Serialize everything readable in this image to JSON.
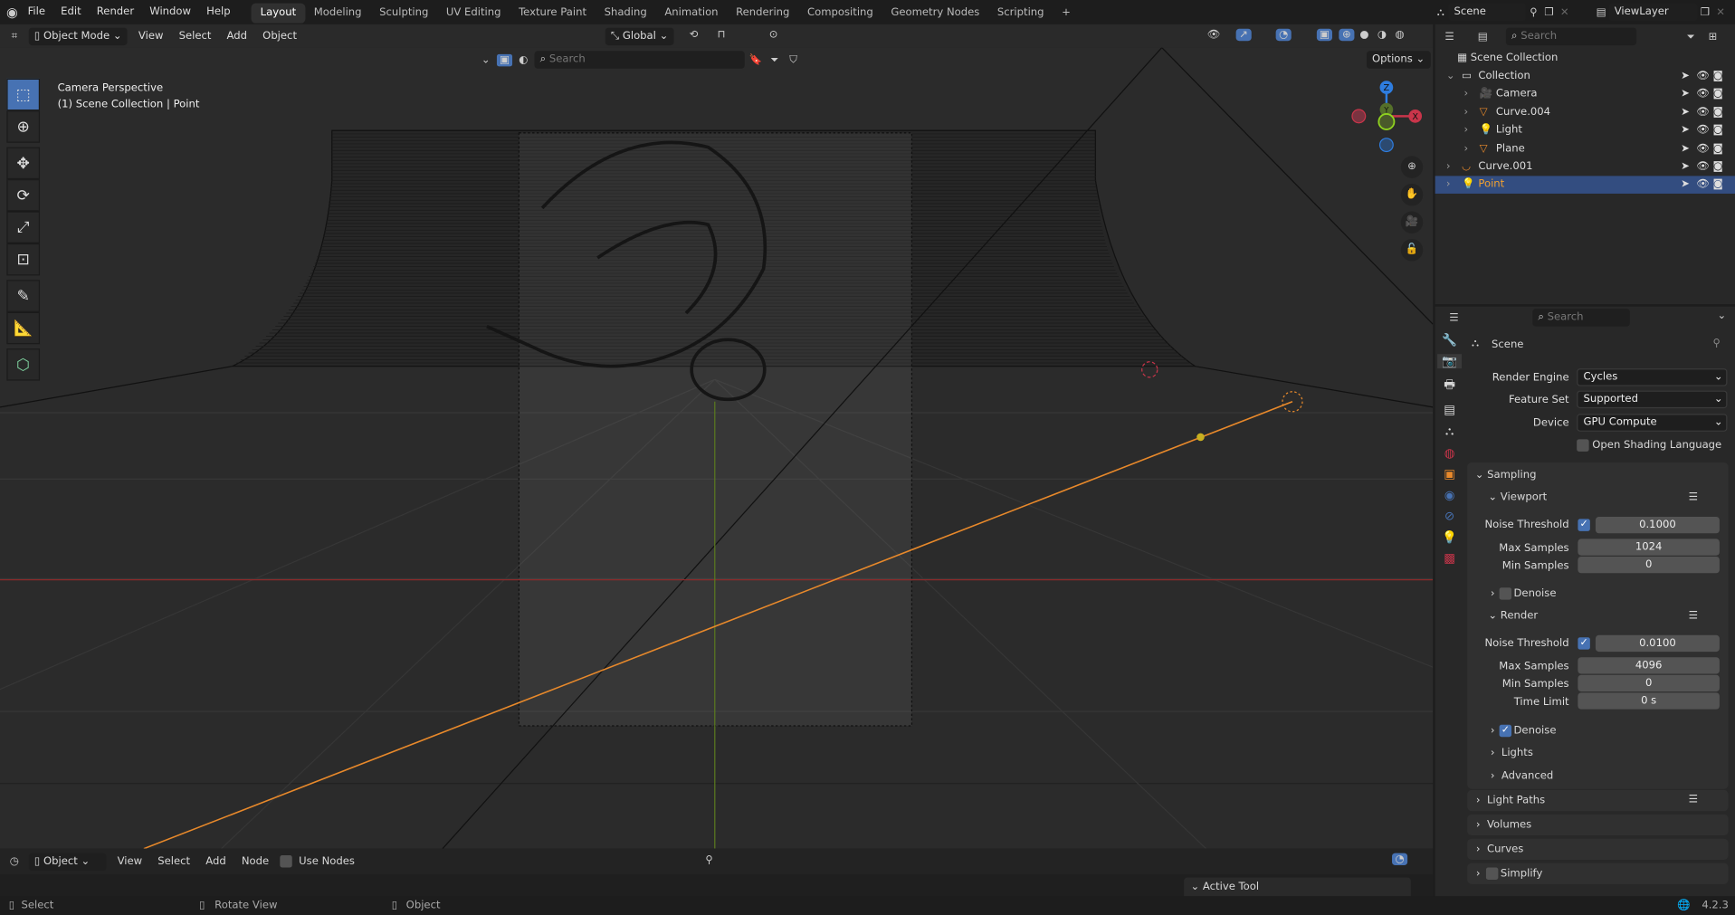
{
  "menu": [
    "File",
    "Edit",
    "Render",
    "Window",
    "Help"
  ],
  "workspaces": [
    "Layout",
    "Modeling",
    "Sculpting",
    "UV Editing",
    "Texture Paint",
    "Shading",
    "Animation",
    "Rendering",
    "Compositing",
    "Geometry Nodes",
    "Scripting"
  ],
  "active_workspace": "Layout",
  "scene": {
    "name": "Scene",
    "view_layer": "ViewLayer"
  },
  "viewport_header": {
    "mode": "Object Mode",
    "menus": [
      "View",
      "Select",
      "Add",
      "Object"
    ],
    "orientation": "Global",
    "search_placeholder": "Search",
    "options": "Options"
  },
  "viewport_overlay": {
    "line1": "Camera Perspective",
    "line2": "(1) Scene Collection | Point"
  },
  "gizmo": {
    "z": "Z",
    "y": "Y",
    "x": "X"
  },
  "outliner": {
    "search_placeholder": "Search",
    "root": "Scene Collection",
    "items": [
      {
        "name": "Collection",
        "type": "collection"
      },
      {
        "name": "Camera",
        "type": "camera"
      },
      {
        "name": "Curve.004",
        "type": "mesh"
      },
      {
        "name": "Light",
        "type": "light"
      },
      {
        "name": "Plane",
        "type": "mesh"
      },
      {
        "name": "Curve.001",
        "type": "curve"
      },
      {
        "name": "Point",
        "type": "light",
        "selected": true
      }
    ]
  },
  "properties": {
    "search_placeholder": "Search",
    "context": "Scene",
    "render_engine": {
      "label": "Render Engine",
      "value": "Cycles"
    },
    "feature_set": {
      "label": "Feature Set",
      "value": "Supported"
    },
    "device": {
      "label": "Device",
      "value": "GPU Compute"
    },
    "osl": {
      "label": "Open Shading Language",
      "checked": false
    },
    "sampling": "Sampling",
    "viewport": {
      "title": "Viewport",
      "noise_label": "Noise Threshold",
      "noise_checked": true,
      "noise": "0.1000",
      "max_label": "Max Samples",
      "max": "1024",
      "min_label": "Min Samples",
      "min": "0",
      "denoise": "Denoise",
      "denoise_checked": false
    },
    "render": {
      "title": "Render",
      "noise_label": "Noise Threshold",
      "noise_checked": true,
      "noise": "0.0100",
      "max_label": "Max Samples",
      "max": "4096",
      "min_label": "Min Samples",
      "min": "0",
      "time_label": "Time Limit",
      "time": "0 s",
      "denoise": "Denoise",
      "denoise_checked": true
    },
    "sub": [
      "Lights",
      "Advanced"
    ],
    "panels": [
      "Light Paths",
      "Volumes",
      "Curves",
      "Simplify"
    ]
  },
  "timeline": {
    "mode": "Object",
    "menus": [
      "View",
      "Select",
      "Add",
      "Node"
    ],
    "use_nodes": "Use Nodes",
    "active_tool": "Active Tool"
  },
  "statusbar": {
    "select": "Select",
    "rotate": "Rotate View",
    "object": "Object",
    "version": "4.2.3"
  },
  "colors": {
    "accent": "#4772b3",
    "selected_row": "#334d80",
    "orange": "#e8892b",
    "axis_x": "#c9354a",
    "axis_y": "#7fad1f",
    "axis_z": "#2e7de0"
  }
}
